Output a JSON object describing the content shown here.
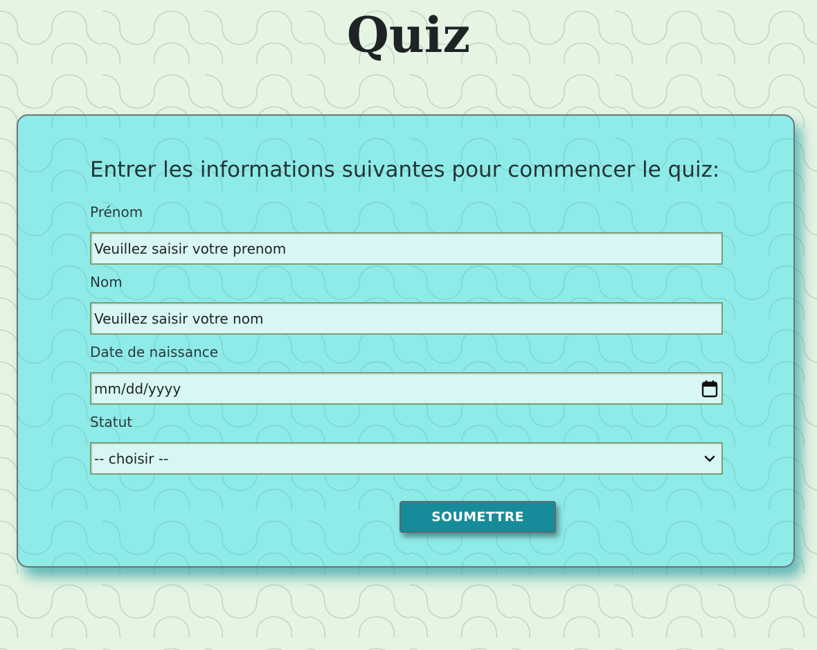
{
  "page": {
    "title": "Quiz"
  },
  "form": {
    "heading": "Entrer les informations suivantes pour commencer le quiz:",
    "fields": [
      {
        "label": "Prénom",
        "placeholder": "Veuillez saisir votre prenom",
        "type": "text"
      },
      {
        "label": "Nom",
        "placeholder": "Veuillez saisir votre nom",
        "type": "text"
      },
      {
        "label": "Date de naissance",
        "value": "mm/dd/yyyy",
        "type": "date",
        "icon": "calendar-icon"
      },
      {
        "label": "Statut",
        "selected": "-- choisir --",
        "type": "select",
        "icon": "chevron-down-icon"
      }
    ],
    "submit_label": "SOUMETTRE"
  },
  "colors": {
    "page_background": "#e6f4e4",
    "card_background": "#8aeae8",
    "input_background": "#d8f6f3",
    "input_border": "#7f9e73",
    "button_background": "#168c9a",
    "button_text": "#ffffff"
  }
}
